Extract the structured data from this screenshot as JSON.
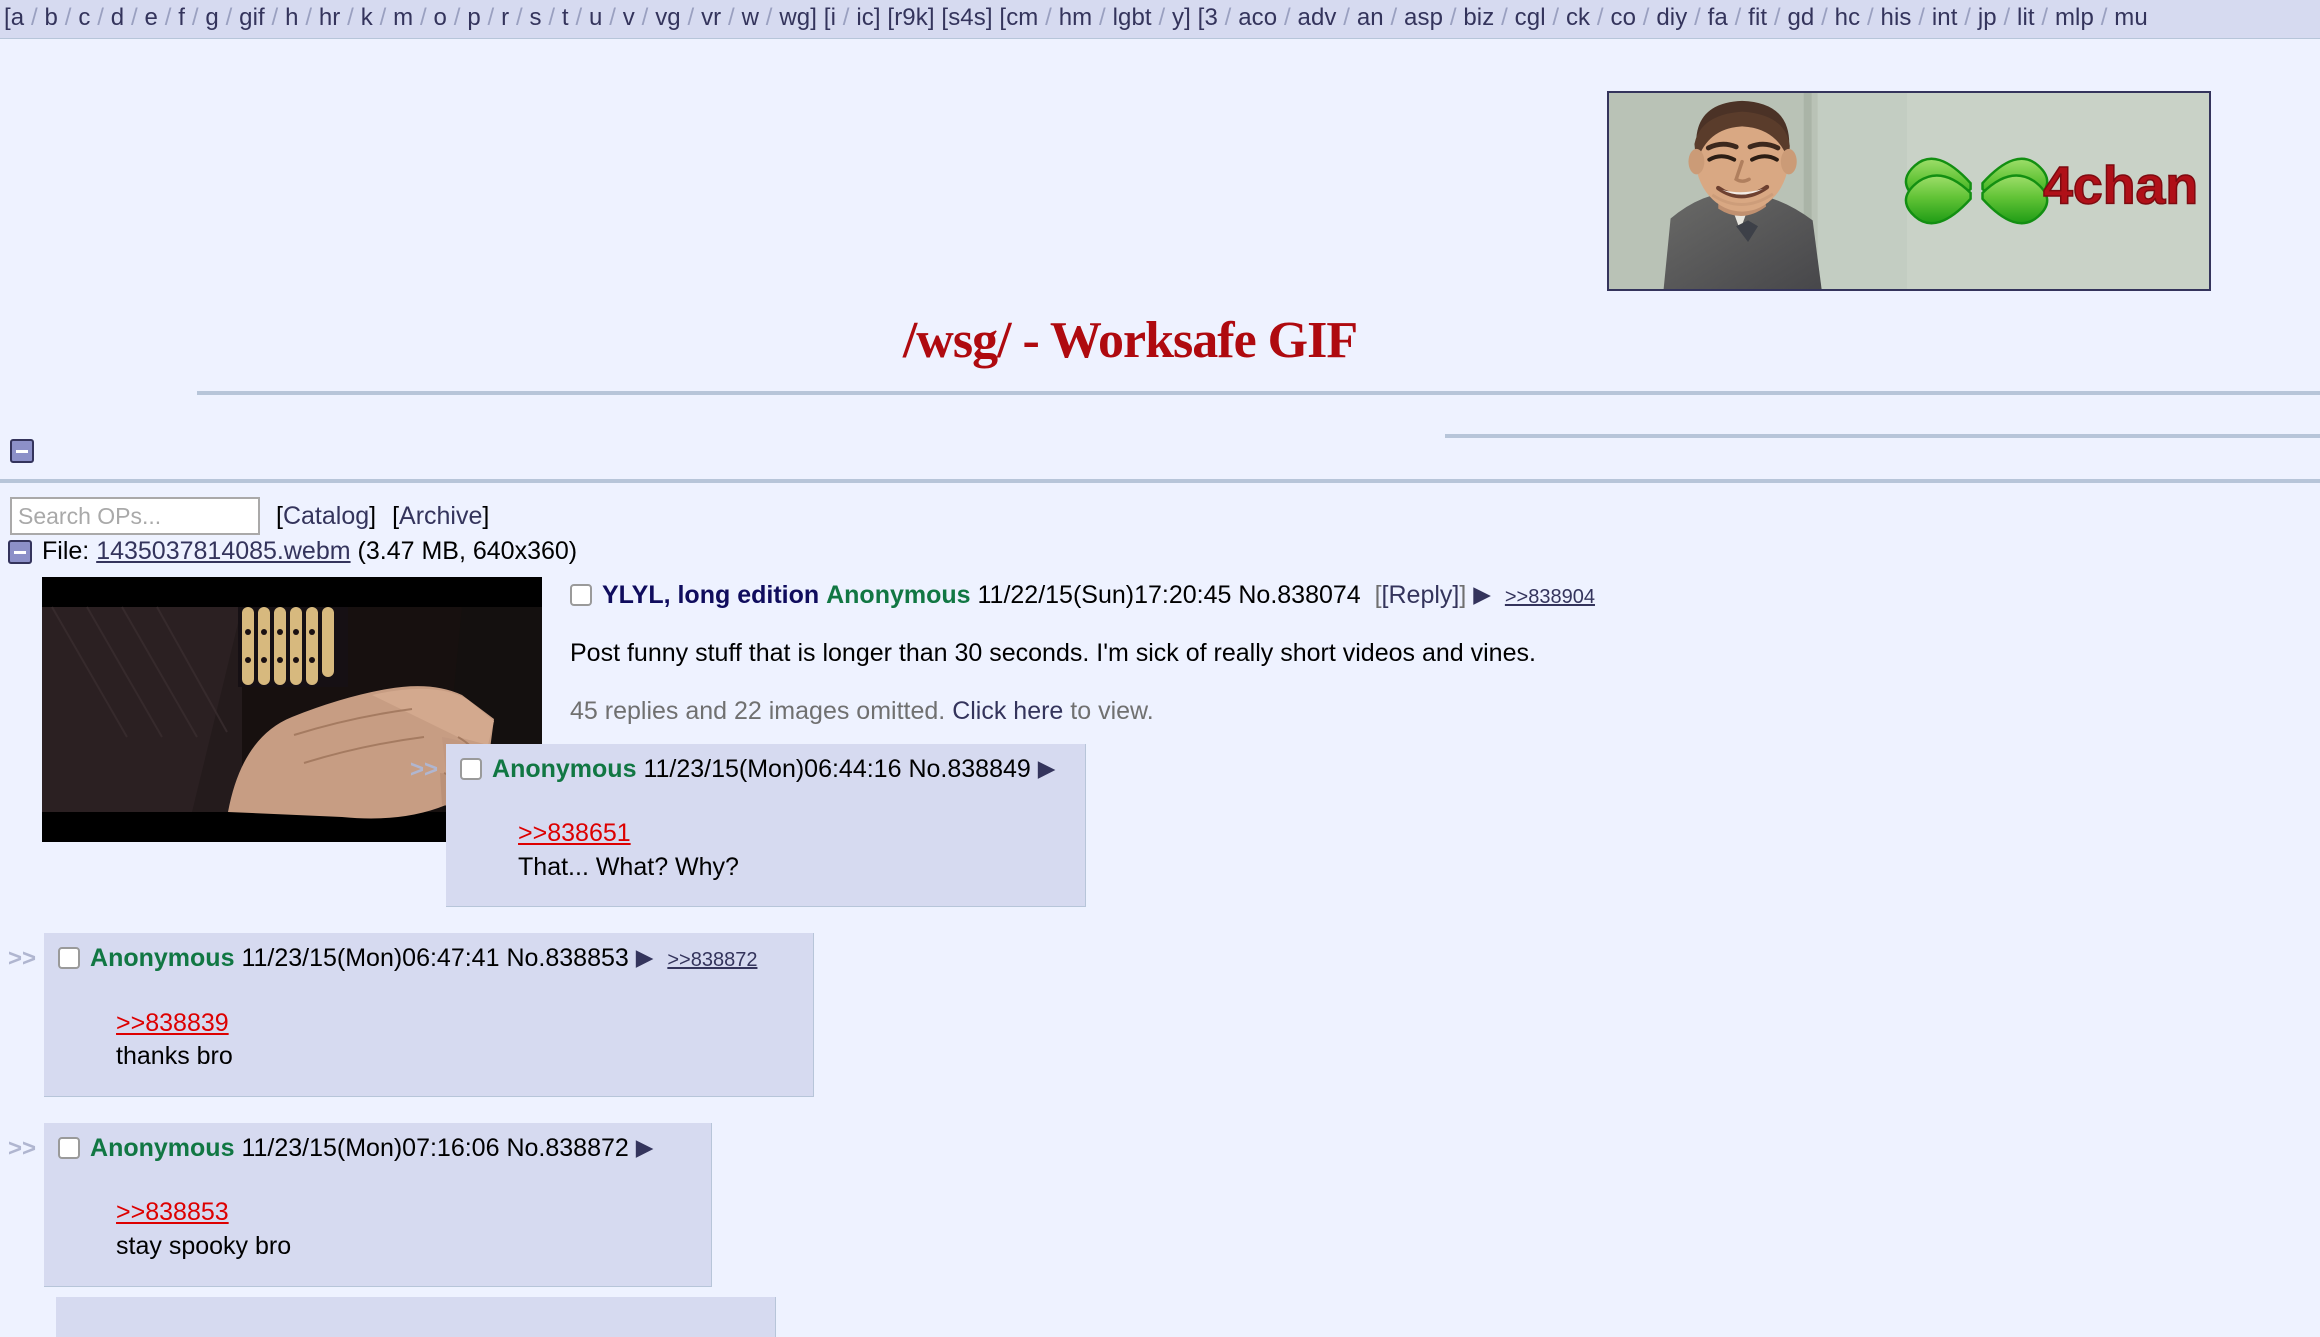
{
  "boardlist": {
    "groups": [
      {
        "open": "[",
        "boards": [
          "a",
          "b",
          "c",
          "d",
          "e",
          "f",
          "g",
          "gif",
          "h",
          "hr",
          "k",
          "m",
          "o",
          "p",
          "r",
          "s",
          "t",
          "u",
          "v",
          "vg",
          "vr",
          "w",
          "wg"
        ],
        "close": "]"
      },
      {
        "open": "[",
        "boards": [
          "i",
          "ic"
        ],
        "close": "]"
      },
      {
        "open": "[",
        "boards": [
          "r9k"
        ],
        "close": "]"
      },
      {
        "open": "[",
        "boards": [
          "s4s"
        ],
        "close": "]"
      },
      {
        "open": "[",
        "boards": [
          "cm",
          "hm",
          "lgbt",
          "y"
        ],
        "close": "]"
      },
      {
        "open": "[",
        "boards": [
          "3",
          "aco",
          "adv",
          "an",
          "asp",
          "biz",
          "cgl",
          "ck",
          "co",
          "diy",
          "fa",
          "fit",
          "gd",
          "hc",
          "his",
          "int",
          "jp",
          "lit",
          "mlp",
          "mu"
        ],
        "close": ""
      }
    ]
  },
  "banner": {
    "logo_text": "4chan",
    "alt": "4chan banner with smiling man and green clover"
  },
  "board": {
    "title": "/wsg/ - Worksafe GIF"
  },
  "toolbar": {
    "search_placeholder": "Search OPs...",
    "search_value": "",
    "catalog_label": "Catalog",
    "archive_label": "Archive"
  },
  "thread": {
    "file": {
      "label": "File:",
      "filename": "1435037814085.webm",
      "meta": "(3.47 MB, 640x360)"
    },
    "op": {
      "subject": "YLYL, long edition",
      "name": "Anonymous",
      "datetime": "11/22/15(Sun)17:20:45",
      "postno": "No.838074",
      "reply_label": "[Reply]",
      "backlinks": [
        ">>838904"
      ],
      "message": "Post funny stuff that is longer than 30 seconds. I'm sick of really short videos and vines.",
      "omitted_prefix": "45 replies and 22 images omitted.",
      "omitted_link": "Click here",
      "omitted_suffix": "to view."
    },
    "replies": [
      {
        "indent": 1,
        "name": "Anonymous",
        "datetime": "11/23/15(Mon)06:44:16",
        "postno": "No.838849",
        "backlinks": [],
        "quote": ">>838651",
        "message": "That... What? Why?"
      },
      {
        "indent": 0,
        "name": "Anonymous",
        "datetime": "11/23/15(Mon)06:47:41",
        "postno": "No.838853",
        "backlinks": [
          ">>838872"
        ],
        "quote": ">>838839",
        "message": "thanks bro"
      },
      {
        "indent": 0,
        "name": "Anonymous",
        "datetime": "11/23/15(Mon)07:16:06",
        "postno": "No.838872",
        "backlinks": [],
        "quote": ">>838853",
        "message": "stay spooky bro"
      }
    ]
  },
  "colors": {
    "page_bg": "#eef2ff",
    "boardlist_bg": "#d6daf0",
    "reply_bg": "#d6daf0",
    "name_green": "#117743",
    "subject_blue": "#0f0c5d",
    "link_blue": "#34345c",
    "quote_red": "#dd0000",
    "title_red": "#af0a0f"
  }
}
